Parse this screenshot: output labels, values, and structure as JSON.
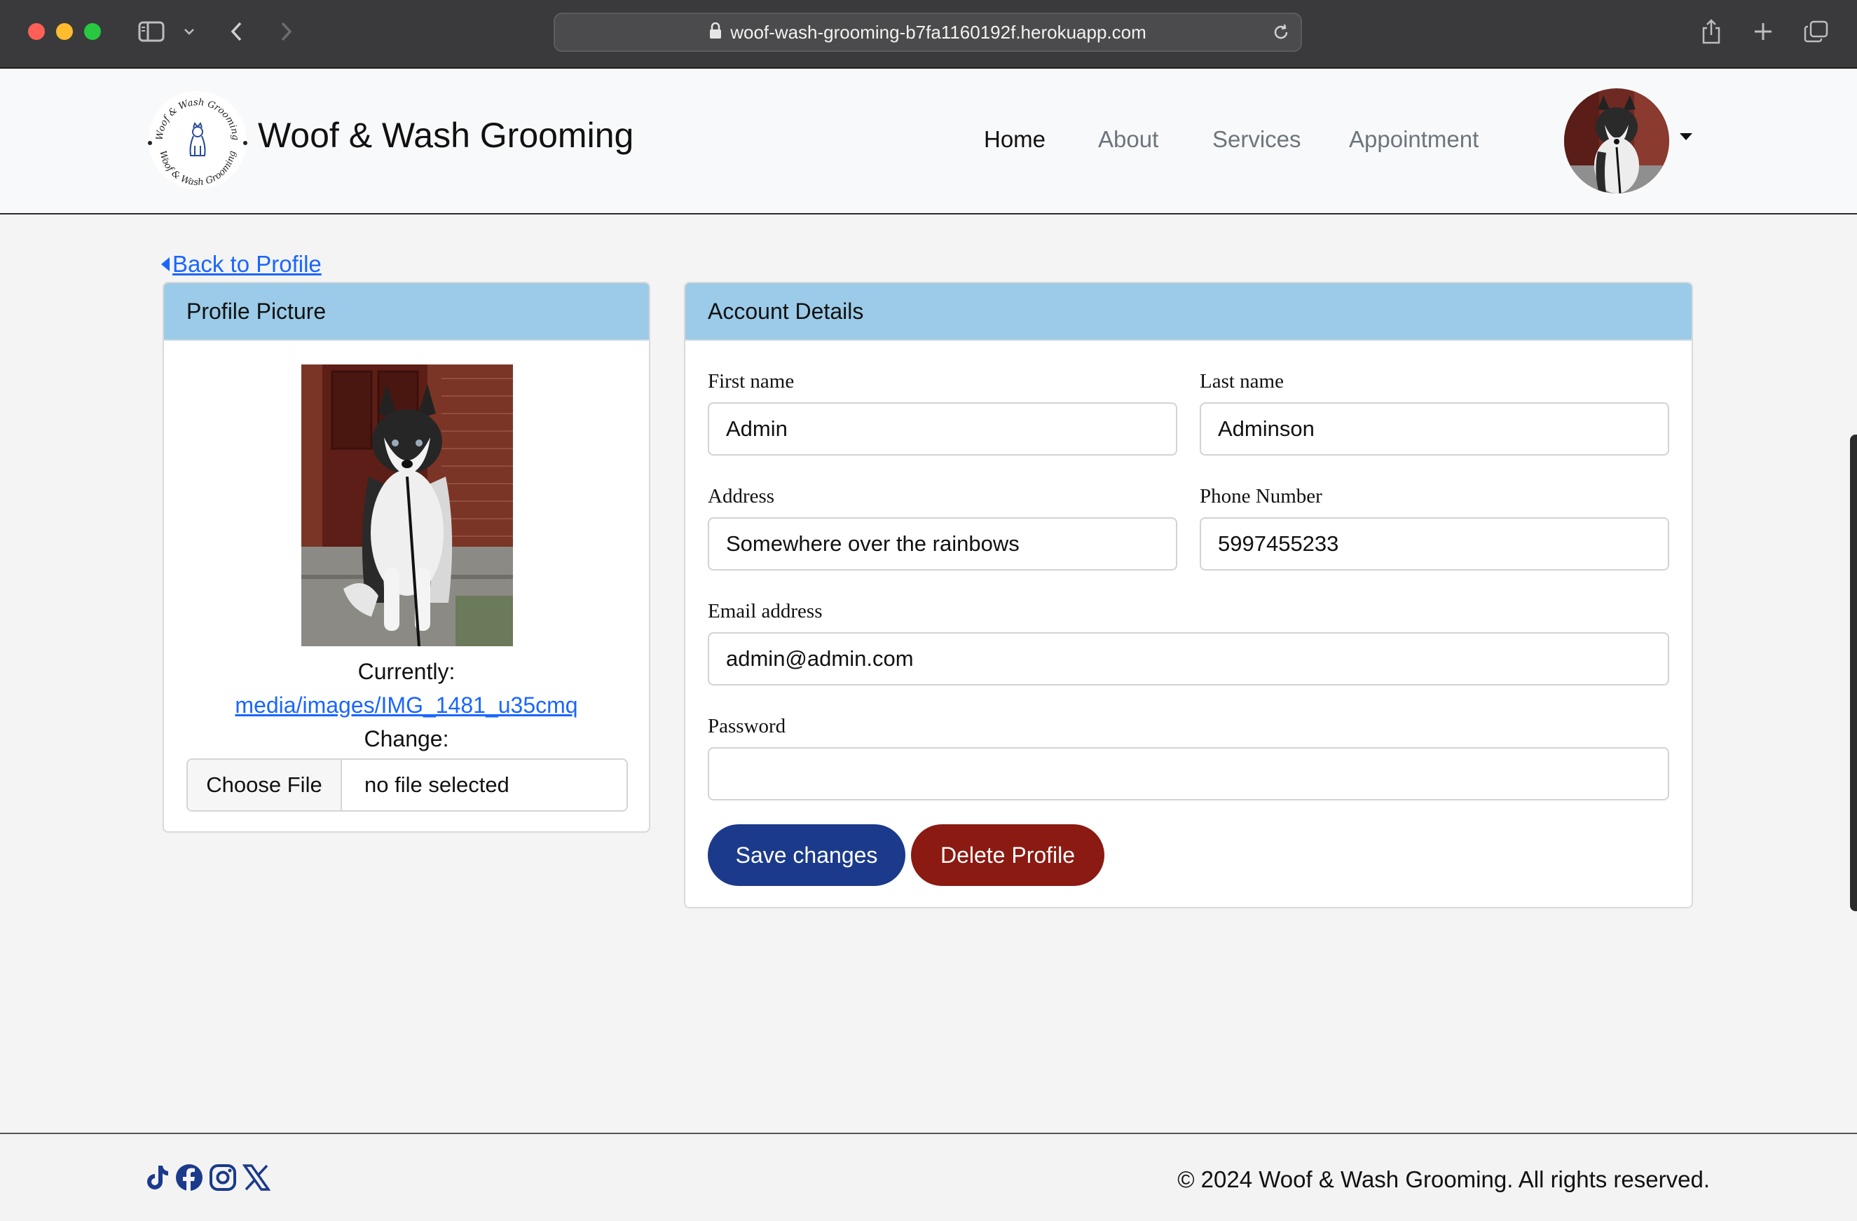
{
  "browser": {
    "url": "woof-wash-grooming-b7fa1160192f.herokuapp.com"
  },
  "navbar": {
    "brand_title": "Woof & Wash Grooming",
    "logo_ring_text": "Woof & Wash Grooming",
    "links": [
      {
        "label": "Home",
        "active": true
      },
      {
        "label": "About",
        "active": false
      },
      {
        "label": "Services",
        "active": false
      },
      {
        "label": "Appointment",
        "active": false
      }
    ]
  },
  "back_link": "Back to Profile",
  "profile_picture": {
    "header": "Profile Picture",
    "currently_label": "Currently:",
    "current_file": "media/images/IMG_1481_u35cmq",
    "change_label": "Change:",
    "choose_button": "Choose File",
    "no_file_text": "no file selected"
  },
  "account": {
    "header": "Account Details",
    "first_name": {
      "label": "First name",
      "value": "Admin"
    },
    "last_name": {
      "label": "Last name",
      "value": "Adminson"
    },
    "address": {
      "label": "Address",
      "value": "Somewhere over the rainbows"
    },
    "phone": {
      "label": "Phone Number",
      "value": "5997455233"
    },
    "email": {
      "label": "Email address",
      "value": "admin@admin.com"
    },
    "password": {
      "label": "Password",
      "value": ""
    },
    "save_button": "Save changes",
    "delete_button": "Delete Profile"
  },
  "footer": {
    "social_icons": [
      "tiktok-icon",
      "facebook-icon",
      "instagram-icon",
      "x-icon"
    ],
    "copyright": "© 2024 Woof & Wash Grooming. All rights reserved."
  },
  "colors": {
    "card_header": "#9bcbe8",
    "save_button": "#1b3a8c",
    "delete_button": "#8b1a12",
    "link": "#1a66ff",
    "social_icon": "#1b3a8c"
  }
}
